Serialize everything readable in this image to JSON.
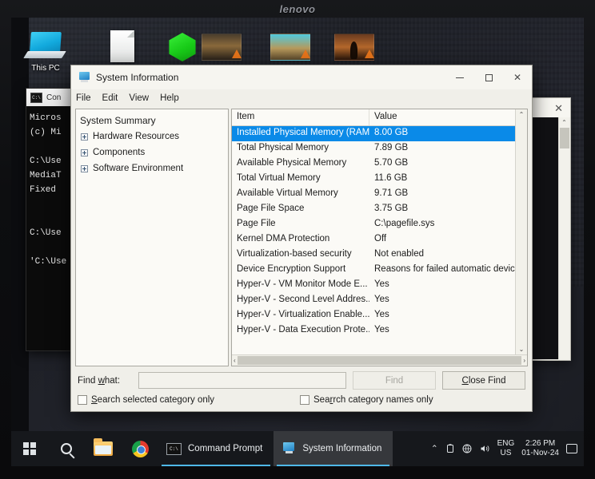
{
  "device": {
    "brand": "lenovo"
  },
  "desktop": {
    "icons": [
      {
        "name": "this-pc",
        "label": "This PC"
      },
      {
        "name": "document",
        "label": ""
      },
      {
        "name": "green-hexagon",
        "label": ""
      },
      {
        "name": "photo-1",
        "label": ""
      },
      {
        "name": "photo-2",
        "label": ""
      },
      {
        "name": "photo-3",
        "label": ""
      }
    ]
  },
  "cmd_window": {
    "title": "Con",
    "icon": "cmd-icon",
    "lines": [
      "Micros",
      "(c) Mi",
      "",
      "C:\\Use",
      "MediaT",
      "Fixed",
      "",
      "",
      "C:\\Use",
      "",
      "'C:\\Use"
    ]
  },
  "background_window": {
    "close_label": "✕"
  },
  "sysinfo": {
    "title": "System Information",
    "icon": "system-information-icon",
    "window_buttons": {
      "minimize": "–",
      "maximize": "□",
      "close": "✕"
    },
    "menu": [
      "File",
      "Edit",
      "View",
      "Help"
    ],
    "tree": {
      "root": "System Summary",
      "children": [
        "Hardware Resources",
        "Components",
        "Software Environment"
      ]
    },
    "columns": {
      "item": "Item",
      "value": "Value"
    },
    "rows": [
      {
        "item": "Installed Physical Memory (RAM)",
        "value": "8.00 GB",
        "selected": true
      },
      {
        "item": "Total Physical Memory",
        "value": "7.89 GB",
        "selected": false
      },
      {
        "item": "Available Physical Memory",
        "value": "5.70 GB",
        "selected": false
      },
      {
        "item": "Total Virtual Memory",
        "value": "11.6 GB",
        "selected": false
      },
      {
        "item": "Available Virtual Memory",
        "value": "9.71 GB",
        "selected": false
      },
      {
        "item": "Page File Space",
        "value": "3.75 GB",
        "selected": false
      },
      {
        "item": "Page File",
        "value": "C:\\pagefile.sys",
        "selected": false
      },
      {
        "item": "Kernel DMA Protection",
        "value": "Off",
        "selected": false
      },
      {
        "item": "Virtualization-based security",
        "value": "Not enabled",
        "selected": false
      },
      {
        "item": "Device Encryption Support",
        "value": "Reasons for failed automatic device en",
        "selected": false
      },
      {
        "item": "Hyper-V - VM Monitor Mode E...",
        "value": "Yes",
        "selected": false
      },
      {
        "item": "Hyper-V - Second Level Addres...",
        "value": "Yes",
        "selected": false
      },
      {
        "item": "Hyper-V - Virtualization Enable...",
        "value": "Yes",
        "selected": false
      },
      {
        "item": "Hyper-V - Data Execution Prote...",
        "value": "Yes",
        "selected": false
      }
    ],
    "find": {
      "label_pre": "Find ",
      "label_accel": "w",
      "label_post": "hat:",
      "input_value": "",
      "input_placeholder": "",
      "find_button": "Find",
      "find_button_disabled": true,
      "close_button_pre": "C",
      "close_button_post": "lose Find",
      "checkbox_left_pre": "S",
      "checkbox_left_post": "earch selected category only",
      "checkbox_left_checked": false,
      "checkbox_right_pre": "Sea",
      "checkbox_right_post": "rch category names only",
      "checkbox_right_checked": false
    },
    "scroll": {
      "up": "⌃",
      "down": "⌄",
      "left": "‹",
      "right": "›"
    },
    "selection_color": "#0a8ae8"
  },
  "taskbar": {
    "start": "start-button",
    "search": "search-button",
    "explorer": "file-explorer-button",
    "chrome": "chrome-button",
    "tasks": [
      {
        "label": "Command Prompt",
        "icon": "cmd-icon",
        "active": false
      },
      {
        "label": "System Information",
        "icon": "system-information-icon",
        "active": true
      }
    ],
    "tray": {
      "chevron": "⌃",
      "language_line1": "ENG",
      "language_line2": "US",
      "time": "2:26 PM",
      "date": "01-Nov-24"
    }
  }
}
